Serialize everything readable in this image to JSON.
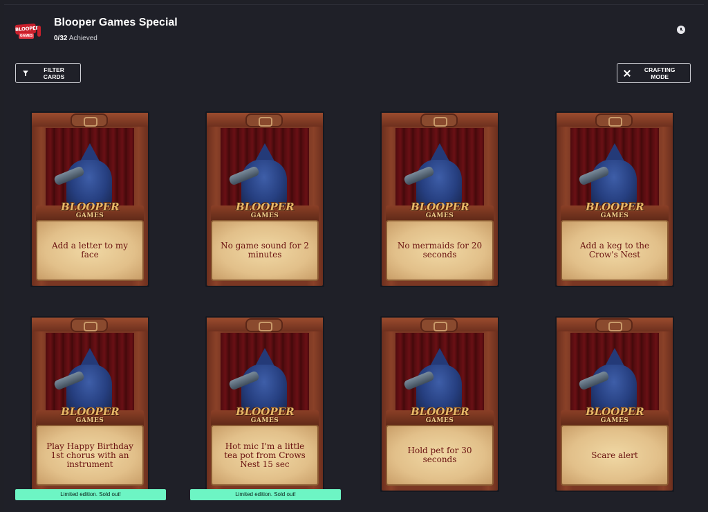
{
  "header": {
    "logo_text": "BLOOPER",
    "logo_sub": "GAMES",
    "title": "Blooper Games Special",
    "progress_count": "0/32",
    "progress_label": "Achieved"
  },
  "toolbar": {
    "filter_label": "FILTER CARDS",
    "crafting_label": "CRAFTING MODE"
  },
  "card_brand": {
    "name": "BLOOPER",
    "sub": "GAMES"
  },
  "cards": [
    {
      "caption": "Add a letter to my face"
    },
    {
      "caption": "No game sound for 2 minutes"
    },
    {
      "caption": "No mermaids for 20 seconds"
    },
    {
      "caption": "Add a keg to the Crow's Nest"
    },
    {
      "caption": "Play Happy Birthday 1st chorus with an instrument",
      "badge": "Limited edition. Sold out!"
    },
    {
      "caption": "Hot mic I'm a little tea pot from Crows Nest 15 sec",
      "badge": "Limited edition. Sold out!"
    },
    {
      "caption": "Hold pet for 30 seconds"
    },
    {
      "caption": "Scare alert"
    }
  ],
  "colors": {
    "background": "#1f2028",
    "badge": "#6df5c4",
    "caption_text": "#6a1210"
  }
}
